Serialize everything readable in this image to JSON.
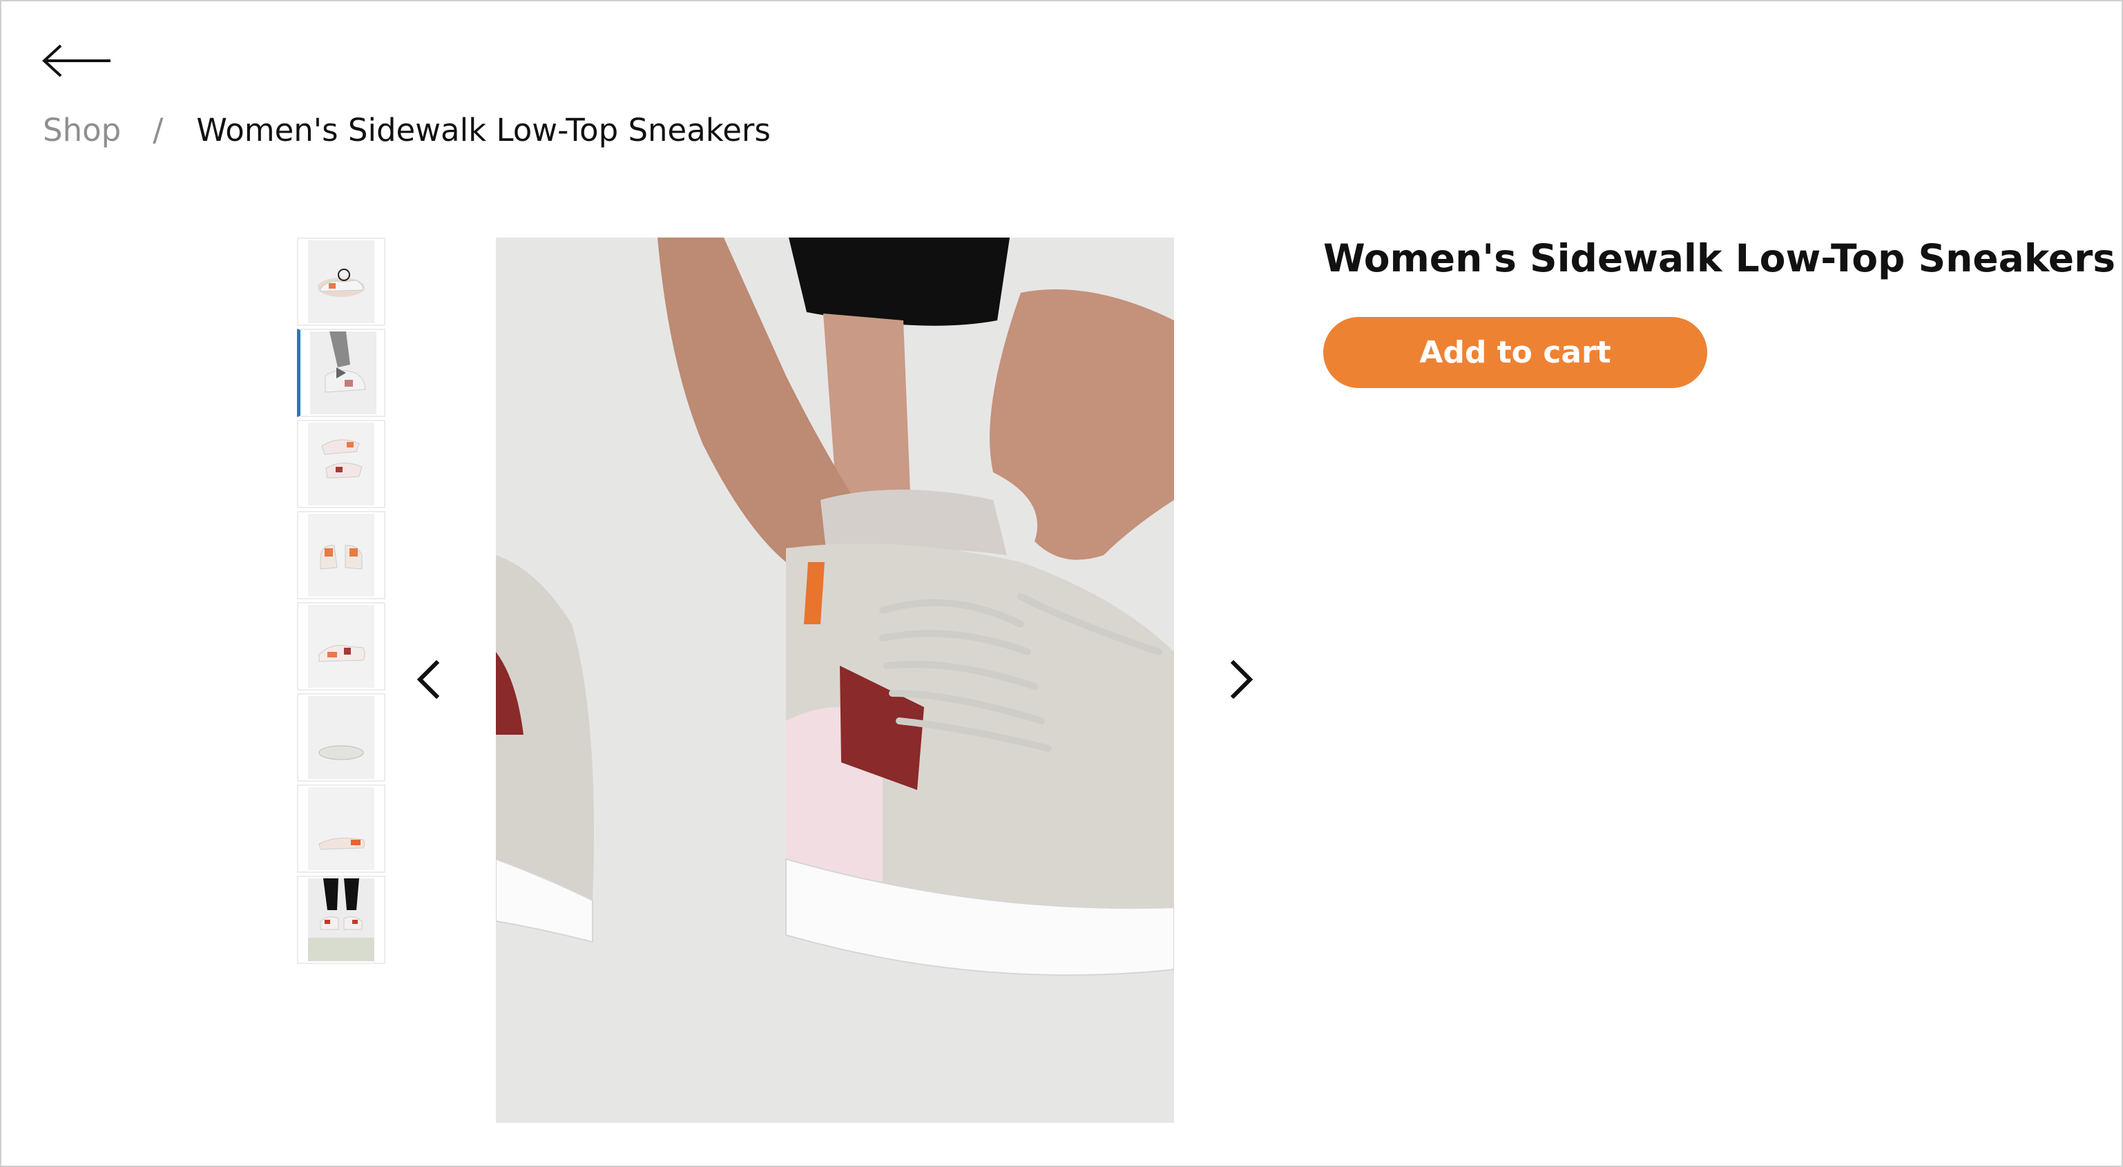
{
  "header": {
    "back_icon": "arrow-left-icon"
  },
  "breadcrumb": {
    "shop_label": "Shop",
    "separator": "/",
    "current_label": "Women's Sidewalk Low-Top Sneakers"
  },
  "gallery": {
    "prev_icon": "chevron-left-icon",
    "next_icon": "chevron-right-icon",
    "thumbnails": [
      {
        "icon": "sneaker-side-thumbnail",
        "active": false
      },
      {
        "icon": "video-play-thumbnail",
        "active": true
      },
      {
        "icon": "sneaker-pair-thumbnail",
        "active": false
      },
      {
        "icon": "sneaker-back-thumbnail",
        "active": false
      },
      {
        "icon": "sneaker-angle-thumbnail",
        "active": false
      },
      {
        "icon": "sneaker-sole-thumbnail",
        "active": false
      },
      {
        "icon": "sneaker-top-thumbnail",
        "active": false
      },
      {
        "icon": "sneaker-worn-thumbnail",
        "active": false
      }
    ]
  },
  "product": {
    "title": "Women's Sidewalk Low-Top Sneakers",
    "add_to_cart_label": "Add to cart"
  },
  "colors": {
    "accent": "#ee8233",
    "active_thumb_border": "#2b74c9",
    "breadcrumb_muted": "#8f8f8f"
  }
}
